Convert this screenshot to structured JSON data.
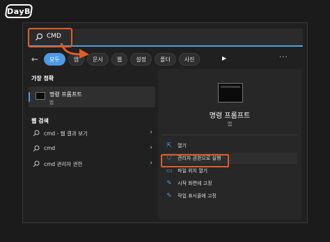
{
  "watermark": "DayB",
  "search": {
    "query": "CMD"
  },
  "filters": {
    "tabs": [
      "모두",
      "앱",
      "문서",
      "웹",
      "설정",
      "폴더",
      "사진"
    ],
    "active_index": 0,
    "more_icon": "more-dots"
  },
  "best_match": {
    "section_title": "가장 정확",
    "name": "명령 프롬프트",
    "kind": "앱"
  },
  "web_search": {
    "section_title": "웹 검색",
    "items": [
      {
        "label": "cmd - 웹 결과 보기"
      },
      {
        "label": "cmd"
      },
      {
        "label": "cmd 관리자 권한"
      }
    ]
  },
  "detail": {
    "name": "명령 프롬프트",
    "kind": "앱",
    "actions": [
      {
        "label": "열기",
        "icon": "open-icon"
      },
      {
        "label": "관리자 권한으로 실행",
        "icon": "admin-shield-icon"
      },
      {
        "label": "파일 위치 열기",
        "icon": "folder-icon"
      },
      {
        "label": "시작 화면에 고정",
        "icon": "pin-icon"
      },
      {
        "label": "작업 표시줄에 고정",
        "icon": "pin-icon"
      }
    ]
  },
  "colors": {
    "accent": "#4d9be6",
    "annotation": "#e35d27"
  }
}
